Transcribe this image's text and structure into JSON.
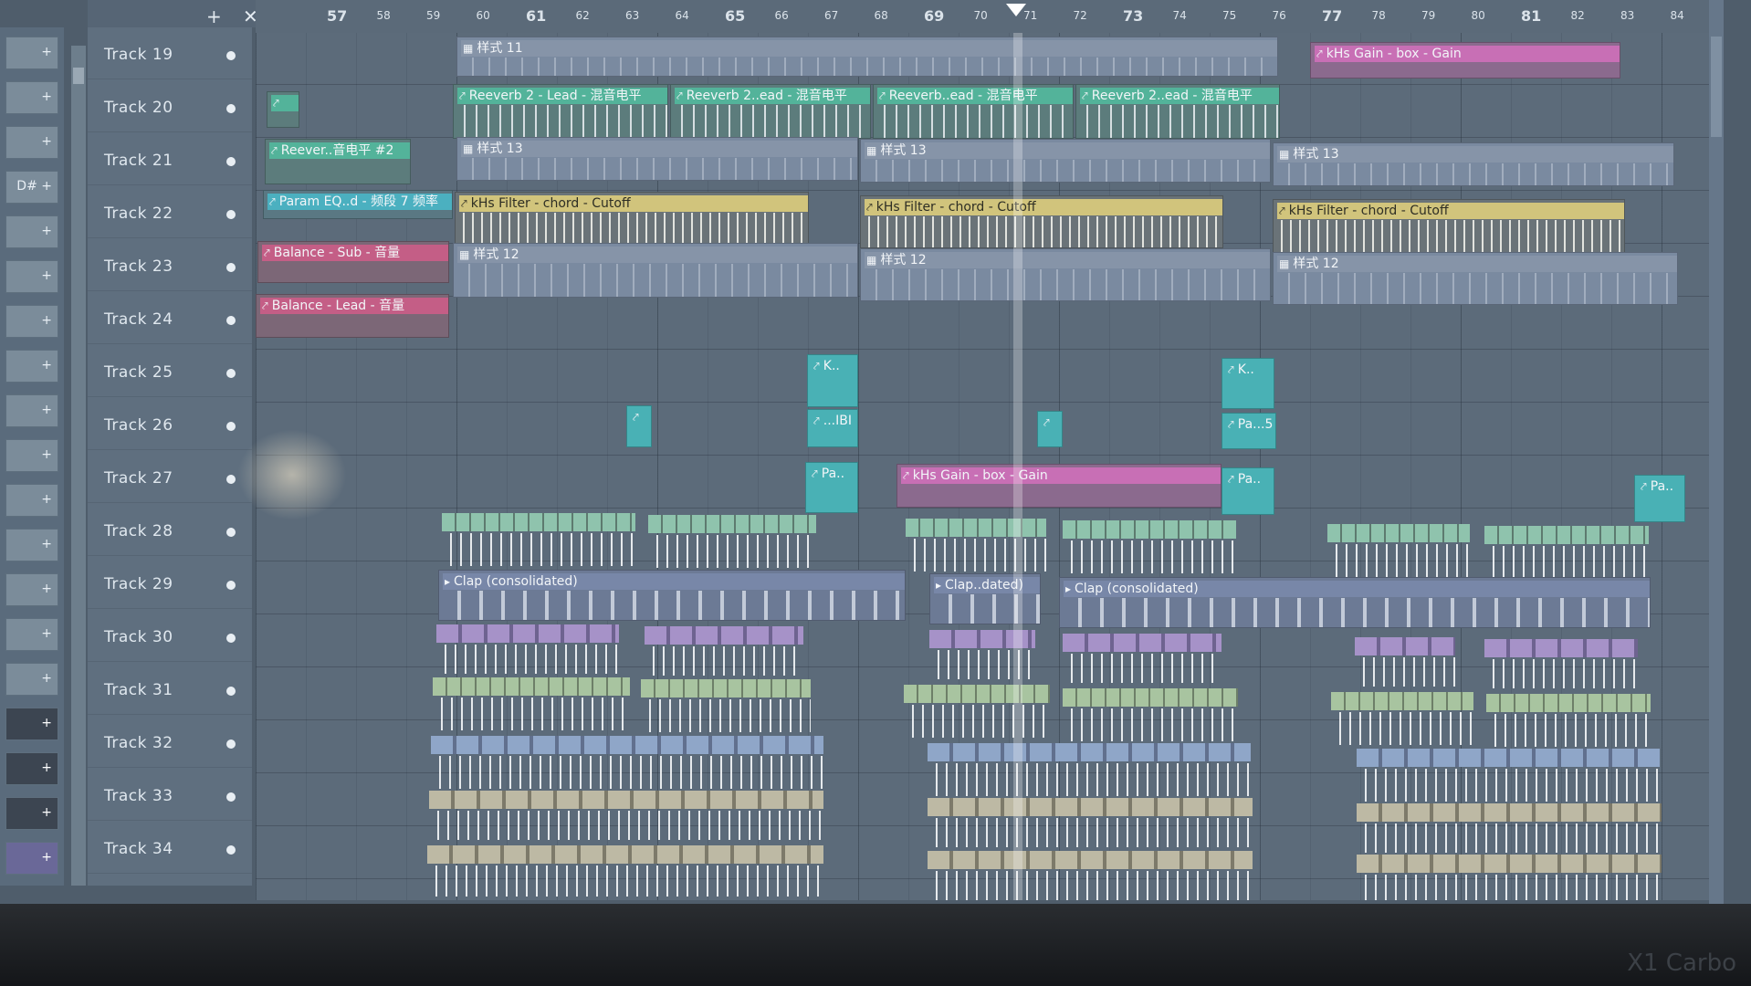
{
  "app": {
    "header_plus": "+",
    "header_close": "✕"
  },
  "timeline": {
    "bars": [
      {
        "n": "57",
        "major": true
      },
      {
        "n": "58"
      },
      {
        "n": "59"
      },
      {
        "n": "60"
      },
      {
        "n": "61",
        "major": true
      },
      {
        "n": "62"
      },
      {
        "n": "63"
      },
      {
        "n": "64"
      },
      {
        "n": "65",
        "major": true
      },
      {
        "n": "66"
      },
      {
        "n": "67"
      },
      {
        "n": "68"
      },
      {
        "n": "69",
        "major": true
      },
      {
        "n": "70"
      },
      {
        "n": "71"
      },
      {
        "n": "72"
      },
      {
        "n": "73",
        "major": true
      },
      {
        "n": "74"
      },
      {
        "n": "75"
      },
      {
        "n": "76"
      },
      {
        "n": "77",
        "major": true
      },
      {
        "n": "78"
      },
      {
        "n": "79"
      },
      {
        "n": "80"
      },
      {
        "n": "81",
        "major": true
      },
      {
        "n": "82"
      },
      {
        "n": "83"
      },
      {
        "n": "84"
      }
    ]
  },
  "tracks": [
    "Track 19",
    "Track 20",
    "Track 21",
    "Track 22",
    "Track 23",
    "Track 24",
    "Track 25",
    "Track 26",
    "Track 27",
    "Track 28",
    "Track 29",
    "Track 30",
    "Track 31",
    "Track 32",
    "Track 33",
    "Track 34"
  ],
  "mixer_buttons": [
    "+",
    "+",
    "+",
    "D# +",
    "+",
    "+",
    "+",
    "+",
    "+",
    "+",
    "+",
    "+",
    "+",
    "+",
    "+",
    "+",
    "+",
    "+",
    "+"
  ],
  "clips": {
    "p11": "样式 11",
    "kgain1": "kHs Gain - box - Gain",
    "rv1": "Reeverb 2 - Lead - 混音电平",
    "rv2": "Reeverb 2..ead - 混音电平",
    "rv3": "Reeverb..ead - 混音电平",
    "rv4": "Reeverb 2..ead - 混音电平",
    "rvshort": "Reever..音电平 #2",
    "p13a": "样式 13",
    "p13b": "样式 13",
    "p13c": "样式 13",
    "param": "Param EQ..d - 频段 7 频率",
    "f1": "kHs Filter - chord - Cutoff",
    "f2": "kHs Filter - chord - Cutoff",
    "f3": "kHs Filter - chord - Cutoff",
    "bal1": "Balance - Sub - 音量",
    "bal2": "Balance - Lead - 音量",
    "p12a": "样式 12",
    "p12b": "样式 12",
    "p12c": "样式 12",
    "k1": "K..",
    "k2": "K..",
    "pa1": "Pa..",
    "pa2": "Pa..",
    "pa3": "Pa..",
    "pa5": "Pa...5",
    "paj": "...IBI",
    "kgain2": "kHs Gain - box - Gain",
    "clap1": "Clap (consolidated)",
    "clap2": "Clap..dated)",
    "clap3": "Clap (consolidated)"
  },
  "footer": {
    "brand": "X1 Carbo"
  }
}
